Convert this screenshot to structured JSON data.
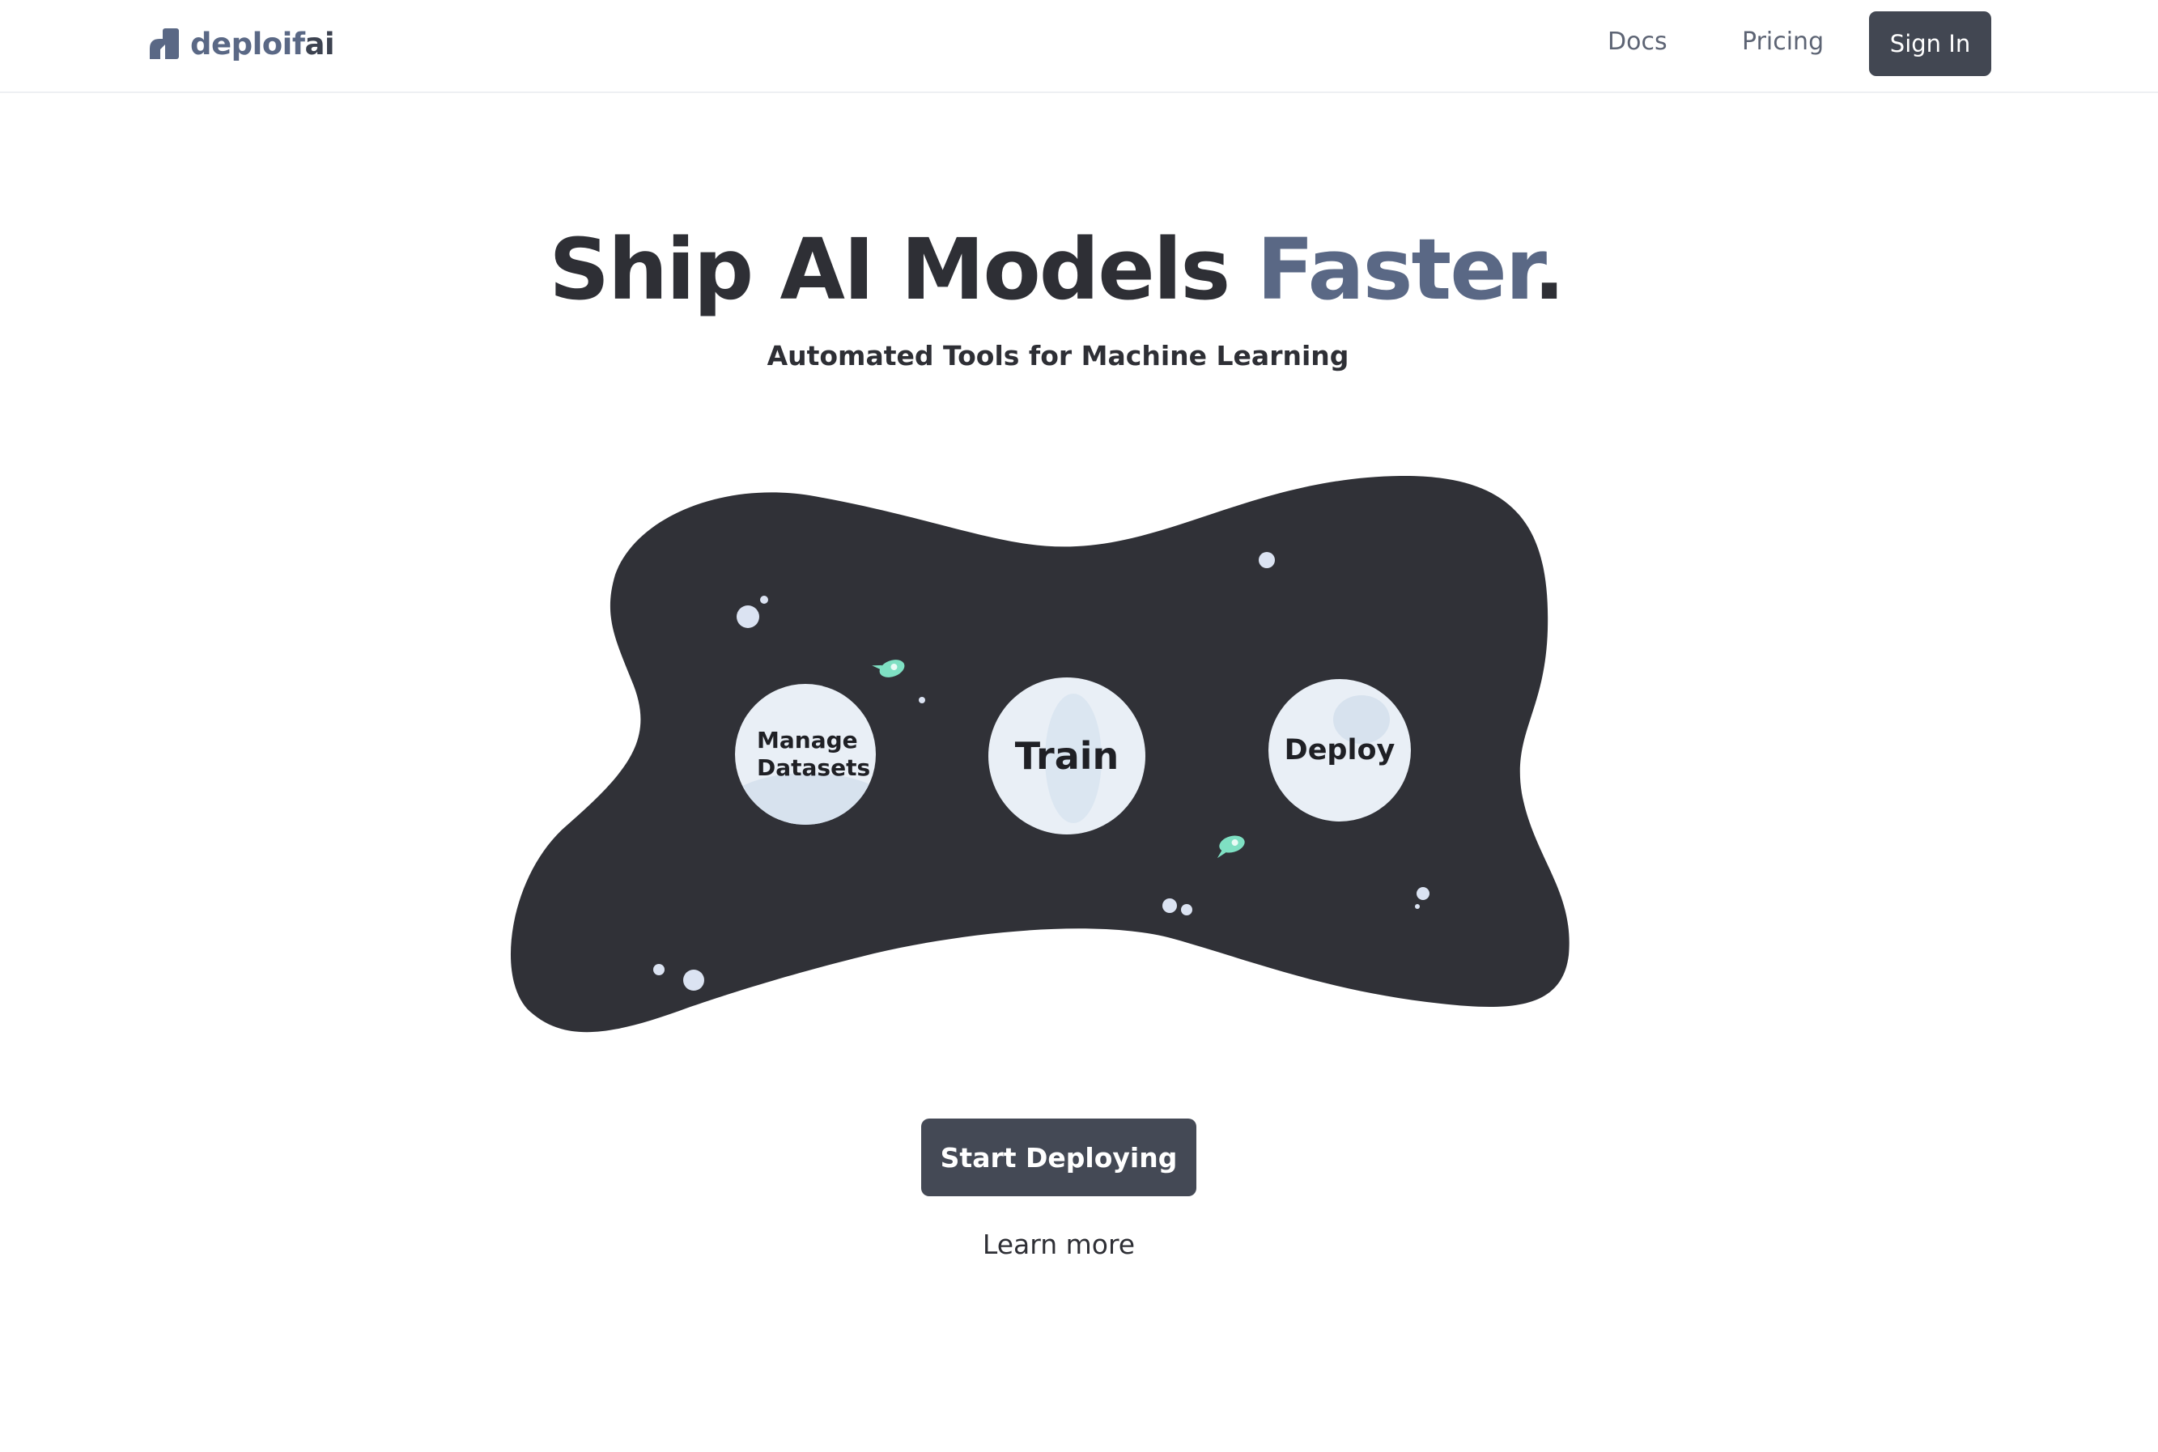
{
  "brand": {
    "name_part1": "deploif",
    "name_part2": "ai"
  },
  "nav": {
    "docs": "Docs",
    "pricing": "Pricing",
    "sign_in": "Sign In"
  },
  "hero": {
    "title_main": "Ship AI Models ",
    "title_accent": "Faster",
    "title_end": ".",
    "subtitle": "Automated Tools for Machine Learning"
  },
  "steps": {
    "manage": "Manage Datasets",
    "train": "Train",
    "deploy": "Deploy"
  },
  "cta": {
    "start": "Start Deploying",
    "learn_more": "Learn more"
  },
  "colors": {
    "accent": "#5a6885",
    "dark": "#2e2f35",
    "button": "#444955",
    "space": "#303137",
    "star": "#dbe3f2",
    "rocket": "#7fe0c3"
  },
  "icons": [
    "logo-icon",
    "rocket-icon",
    "star-icon"
  ]
}
